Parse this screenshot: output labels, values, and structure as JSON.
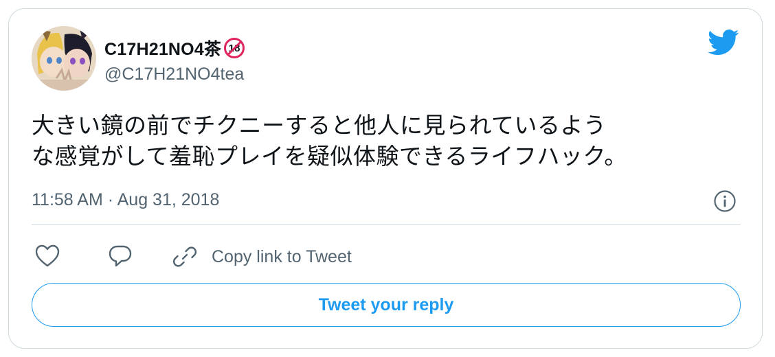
{
  "author": {
    "display_name": "C17H21NO4茶",
    "badge": "18",
    "handle": "@C17H21NO4tea",
    "avatar": "anime-avatar-image"
  },
  "tweet": {
    "text_lines": [
      "大きい鏡の前でチクニーすると他人に見られているよう",
      "な感覚がして羞恥プレイを疑似体験できるライフハック。"
    ],
    "timestamp": "11:58 AM · Aug 31, 2018"
  },
  "actions": {
    "like_icon": "heart-icon",
    "reply_icon": "speech-bubble-icon",
    "copy_icon": "link-icon",
    "copy_label": "Copy link to Tweet"
  },
  "reply_button": {
    "label": "Tweet your reply"
  },
  "icons": {
    "brand": "twitter-bird-icon",
    "info": "info-icon"
  },
  "colors": {
    "brand": "#1d9bf0",
    "secondary_text": "#536471",
    "badge": "#e0245e",
    "border": "#cfd9de"
  }
}
